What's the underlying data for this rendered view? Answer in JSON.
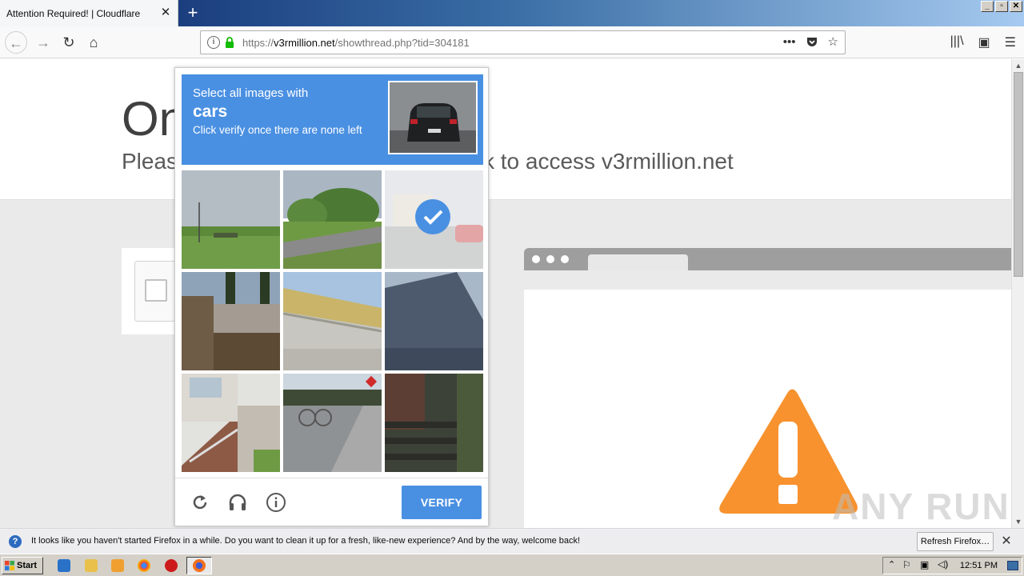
{
  "browser": {
    "tab_title": "Attention Required! | Cloudflare",
    "tab_close": "✕",
    "new_tab": "+",
    "url_prefix": "https://",
    "url_host": "v3rmillion.net",
    "url_path": "/showthread.php?tid=304181",
    "page_actions": "•••"
  },
  "page": {
    "hero_title": "One",
    "hero_subtitle_left": "Pleas",
    "hero_subtitle_right": "k to access v3rmillion.net"
  },
  "challenge": {
    "instruction": "Select all images with",
    "object": "cars",
    "hint": "Click verify once there are none left",
    "verify_label": "VERIFY",
    "tiles": [
      {
        "scene": "grass-field",
        "selected": false
      },
      {
        "scene": "road-trees",
        "selected": false
      },
      {
        "scene": "street-car",
        "selected": true
      },
      {
        "scene": "wall-trees",
        "selected": false
      },
      {
        "scene": "bridge",
        "selected": false
      },
      {
        "scene": "roof",
        "selected": false
      },
      {
        "scene": "stairs-house",
        "selected": false
      },
      {
        "scene": "sidewalk-bikes",
        "selected": false
      },
      {
        "scene": "dark-stairs",
        "selected": false
      }
    ],
    "selected_color": "#4a90e2"
  },
  "notification": {
    "text": "It looks like you haven't started Firefox in a while. Do you want to clean it up for a fresh, like-new experience? And by the way, welcome back!",
    "button": "Refresh Firefox…",
    "close": "✕"
  },
  "taskbar": {
    "start": "Start",
    "clock": "12:51 PM"
  },
  "watermark": "ANY RUN",
  "colors": {
    "accent": "#4a90e2",
    "warning": "#f7922e"
  }
}
